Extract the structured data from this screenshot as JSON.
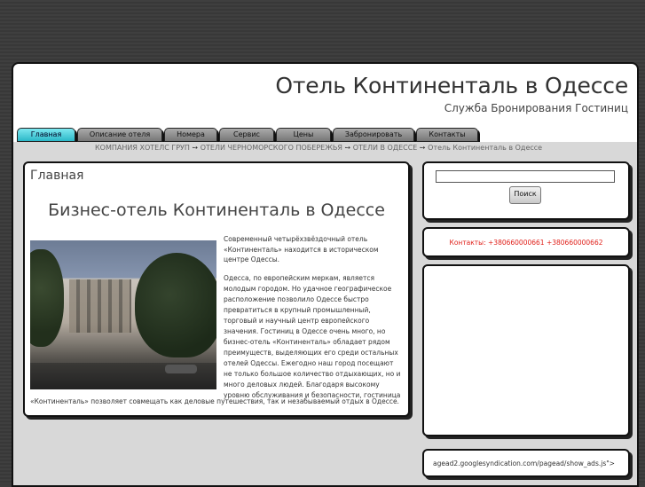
{
  "header": {
    "title": "Отель Континенталь в Одессе",
    "subtitle": "Служба Бронирования Гостиниц"
  },
  "nav": {
    "tabs": [
      {
        "label": "Главная",
        "active": true
      },
      {
        "label": "Описание отеля",
        "active": false
      },
      {
        "label": "Номера",
        "active": false
      },
      {
        "label": "Сервис",
        "active": false
      },
      {
        "label": "Цены",
        "active": false
      },
      {
        "label": "Забронировать",
        "active": false
      },
      {
        "label": "Контакты",
        "active": false
      }
    ]
  },
  "breadcrumb": {
    "items": [
      "КОМПАНИЯ ХОТЕЛС ГРУП",
      "ОТЕЛИ ЧЕРНОМОРСКОГО ПОБЕРЕЖЬЯ",
      "ОТЕЛИ В ОДЕССЕ",
      "Отель Континенталь в Одессе"
    ],
    "separator": "➙"
  },
  "content": {
    "heading": "Главная",
    "title": "Бизнес-отель Континенталь в Одессе",
    "intro": "Современный четырёхзвёздочный отель «Континенталь» находится в историческом центре Одессы.",
    "body": "Одесса, по европейским меркам, является молодым городом. Но удачное географическое расположение позволило Одессе быстро превратиться в крупный промышленный, торговый и научный центр европейского значения. Гостиниц в Одессе очень много, но бизнес-отель «Континенталь» обладает рядом преимуществ, выделяющих его среди остальных отелей Одессы. Ежегодно наш город посещают не только большое количество отдыхающих, но и много деловых людей. Благодаря высокому уровню обслуживания и безопасности, гостиница",
    "tail": "«Континенталь» позволяет совмещать как деловые путешествия, так и незабываемый отдых в Одессе."
  },
  "sidebar": {
    "search_value": "",
    "search_button": "Поиск",
    "contacts": "Контакты: +380660000661 +380660000662",
    "url": "agead2.googlesyndication.com/pagead/show_ads.js\">"
  },
  "colors": {
    "active_tab": "#2bb8c8",
    "contacts_text": "#e0201a",
    "page_background": "#3c3c3c"
  }
}
